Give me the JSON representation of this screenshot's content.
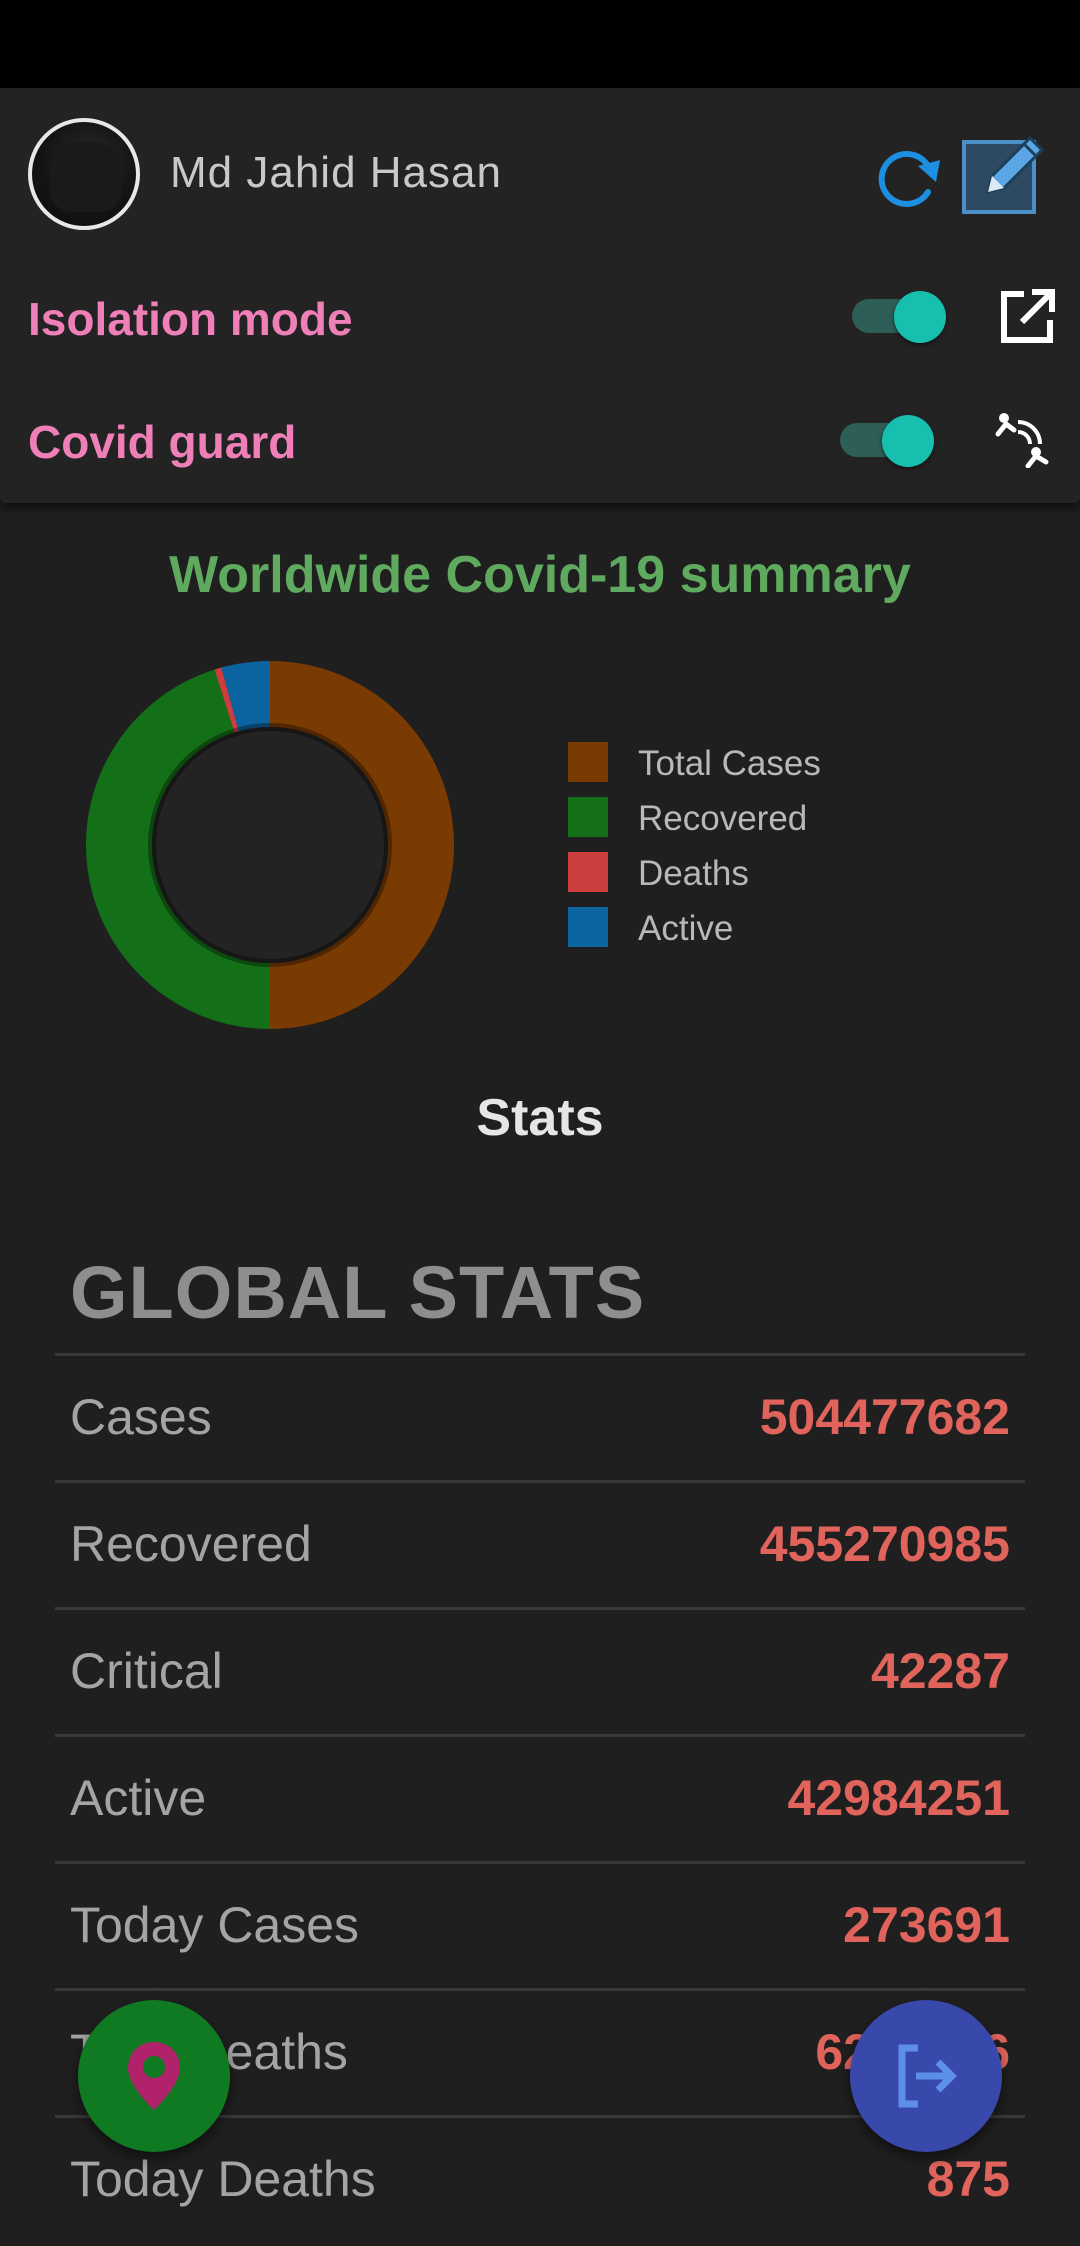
{
  "user": {
    "name": "Md Jahid Hasan"
  },
  "toggles": [
    {
      "label": "Isolation mode",
      "on": true,
      "icon": "external-link-icon"
    },
    {
      "label": "Covid guard",
      "on": true,
      "icon": "contact-tracing-icon"
    }
  ],
  "summary": {
    "title": "Worldwide Covid-19 summary"
  },
  "chart_data": {
    "type": "pie",
    "variant": "donut",
    "categories": [
      "Total Cases",
      "Recovered",
      "Deaths",
      "Active"
    ],
    "values": [
      504477682,
      455270985,
      6222446,
      42984251
    ],
    "colors": [
      "#7a3b02",
      "#137018",
      "#cc3e3e",
      "#0b63a0"
    ],
    "legend": "right"
  },
  "stats": {
    "title": "Stats",
    "global_title": "GLOBAL STATS",
    "rows": [
      {
        "label": "Cases",
        "value": "504477682"
      },
      {
        "label": "Recovered",
        "value": "455270985"
      },
      {
        "label": "Critical",
        "value": "42287"
      },
      {
        "label": "Active",
        "value": "42984251"
      },
      {
        "label": "Today Cases",
        "value": "273691"
      },
      {
        "label": "Total Deaths",
        "value": "6222446"
      },
      {
        "label": "Today Deaths",
        "value": "875"
      }
    ]
  },
  "fabs": {
    "location": "location-pin-icon",
    "logout": "logout-icon"
  },
  "colors": {
    "accent_pink": "#ef7fb7",
    "accent_green": "#5faa5f",
    "value_red": "#e0645c",
    "switch_on": "#17bfae"
  }
}
